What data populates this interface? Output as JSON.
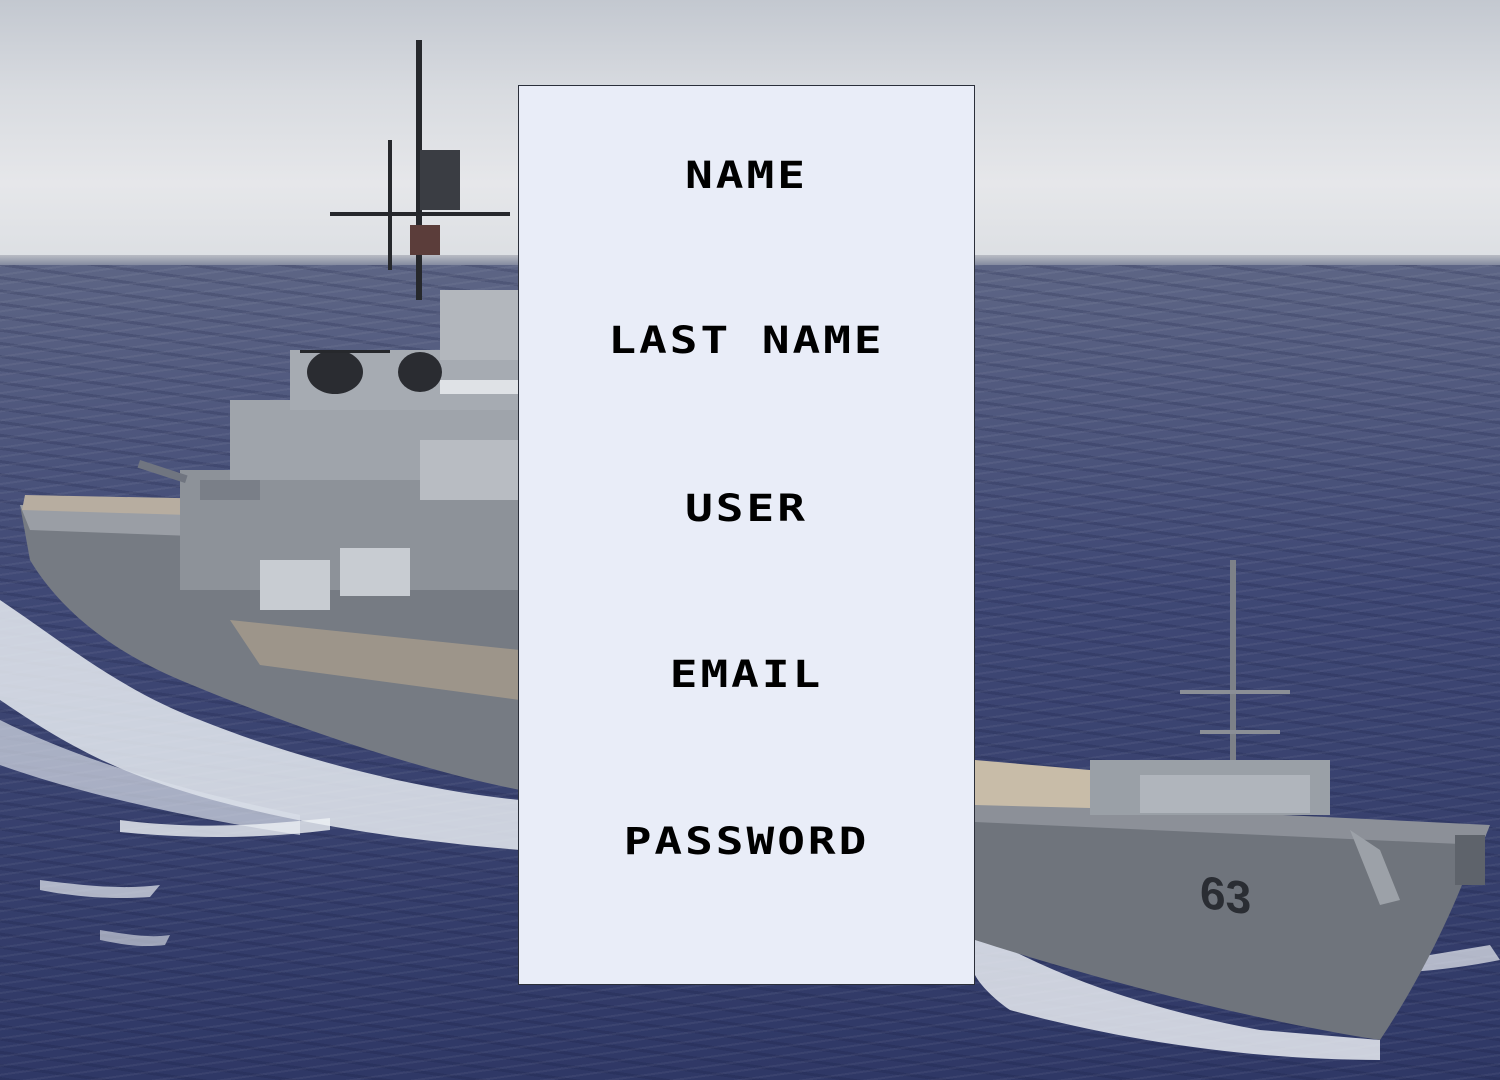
{
  "form": {
    "fields": [
      {
        "label": "NAME"
      },
      {
        "label": "LAST NAME"
      },
      {
        "label": "USER"
      },
      {
        "label": "EMAIL"
      },
      {
        "label": "PASSWORD"
      }
    ]
  },
  "background": {
    "hull_number": "63"
  },
  "colors": {
    "panel_background": "#e9edf8",
    "panel_border": "#2b2f3a",
    "label_text": "#000000"
  }
}
